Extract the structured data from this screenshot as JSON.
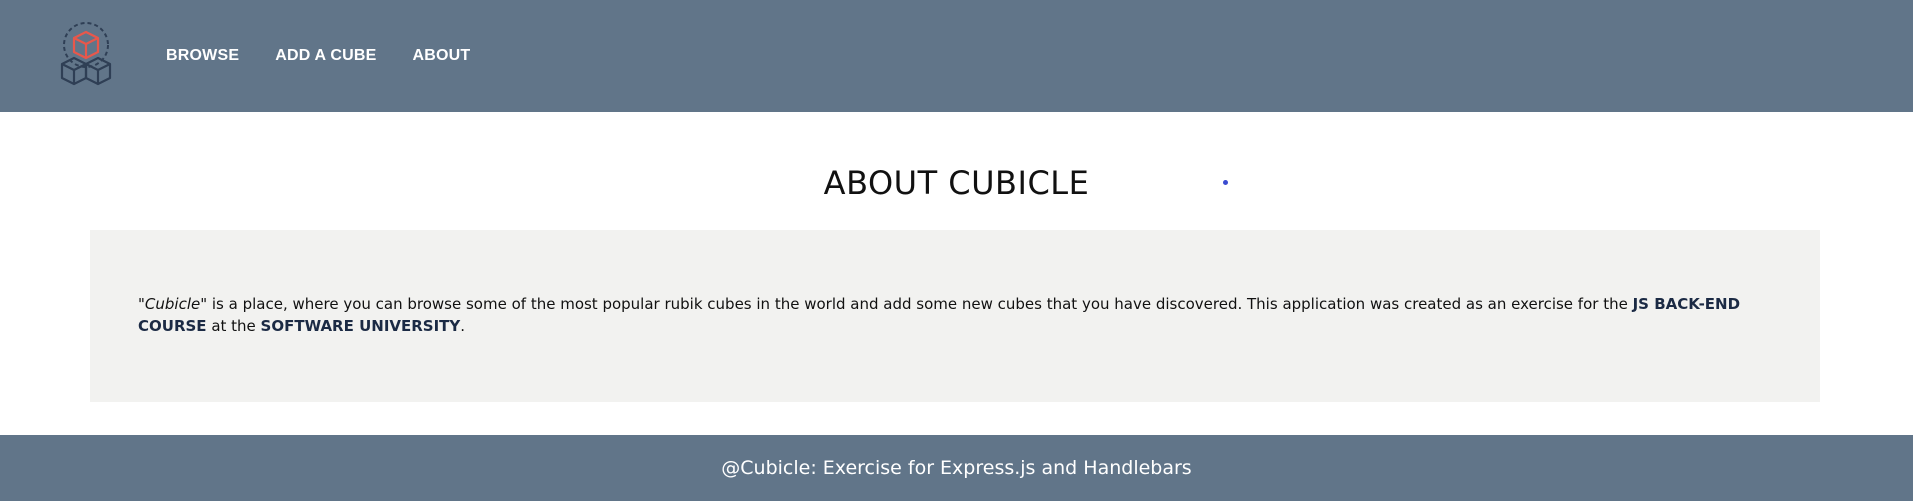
{
  "nav": {
    "items": [
      {
        "label": "BROWSE"
      },
      {
        "label": "ADD A CUBE"
      },
      {
        "label": "ABOUT"
      }
    ]
  },
  "logo": {
    "icon": "cubes-logo-icon",
    "accent_color": "#e8574b",
    "line_color": "#2f3f55"
  },
  "main": {
    "title": "ABOUT CUBICLE",
    "about": {
      "app_name_quoted": "\"Cubicle\"",
      "text_part1": " is a place, where you can browse some of the most popular rubik cubes in the world and add some new cubes that you have discovered. This application was created as an exercise for the ",
      "course": "JS BACK-END COURSE",
      "text_part2": " at the ",
      "university": "SOFTWARE UNIVERSITY",
      "text_end": "."
    }
  },
  "footer": {
    "text": "@Cubicle: Exercise for Express.js and Handlebars"
  },
  "colors": {
    "header_bg": "#617589",
    "box_bg": "#f2f2f0",
    "footer_bg": "#617589"
  }
}
